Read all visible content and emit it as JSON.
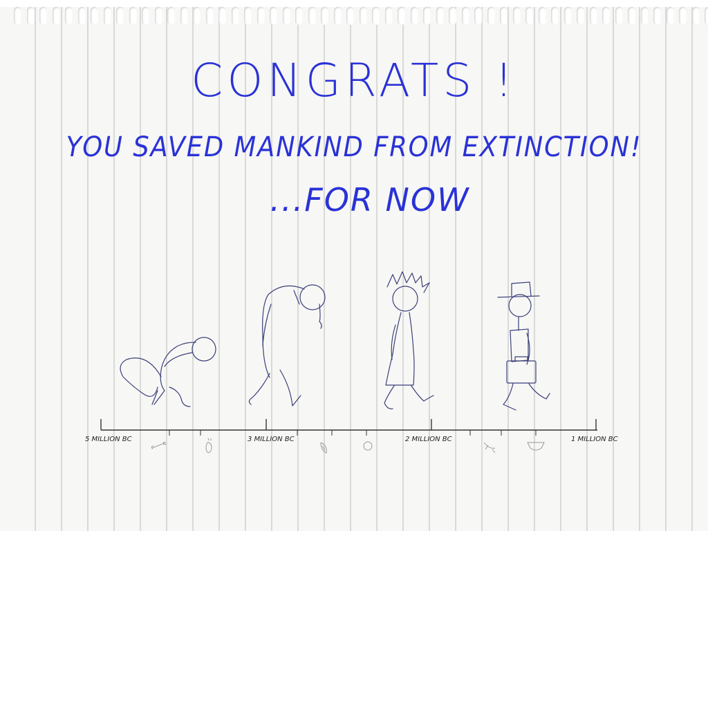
{
  "title": "CONGRATS !",
  "subtitle": "YOU SAVED MANKIND FROM EXTINCTION!",
  "tagline": "...FOR NOW",
  "timeline": {
    "labels": [
      "5 MILLION BC",
      "3 MILLION BC",
      "2 MILLION BC",
      "1 MILLION BC"
    ],
    "item_icons": [
      "bone-icon",
      "footprint-icon",
      "feather-icon",
      "coin-icon",
      "banana-icon",
      "underwear-icon"
    ]
  },
  "figures": [
    "monkey",
    "bent-caveman",
    "punk-human",
    "businessman"
  ],
  "colors": {
    "ink": "#2a32d6",
    "pencil": "#3a3f7a",
    "paper": "#f7f7f5",
    "rule": "#d9d9d7"
  }
}
